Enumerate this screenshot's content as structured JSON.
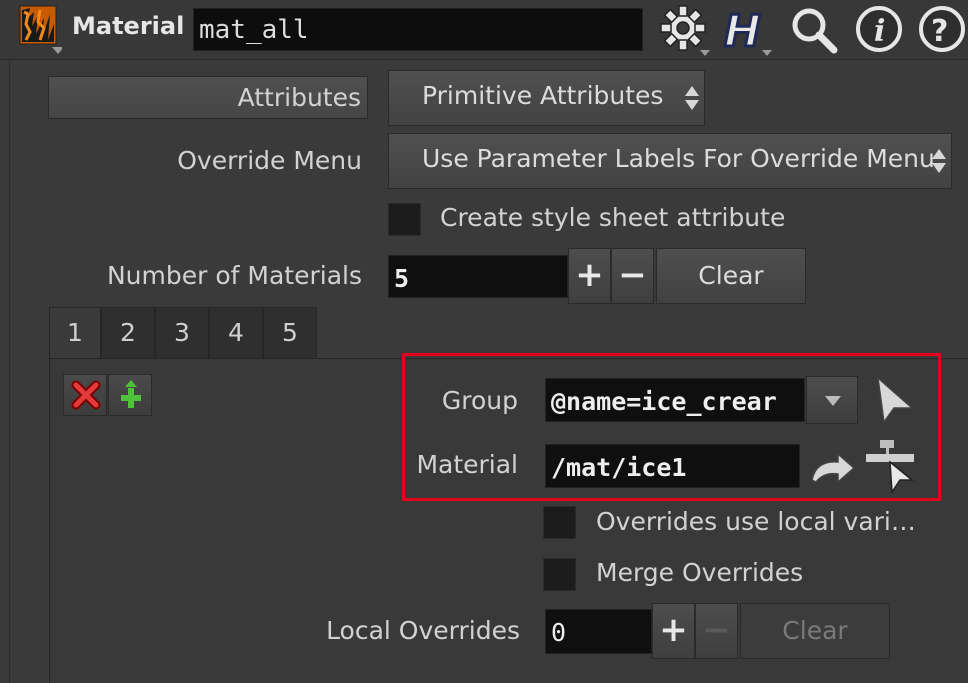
{
  "header": {
    "node_type": "Material",
    "node_name": "mat_all",
    "icons": [
      "node-type-icon",
      "gear-icon",
      "houdini-help-icon",
      "search-icon",
      "info-icon",
      "help-icon"
    ]
  },
  "params": {
    "attributes_label": "Attributes",
    "attributes_value": "Primitive Attributes",
    "override_menu_label": "Override Menu",
    "override_menu_value": "Use Parameter Labels For Override Menu",
    "create_style_sheet_label": "Create style sheet attribute",
    "num_materials_label": "Number of Materials",
    "num_materials_value": "5",
    "clear_label": "Clear"
  },
  "tabs": [
    "1",
    "2",
    "3",
    "4",
    "5"
  ],
  "material_block": {
    "group_label": "Group",
    "group_value": "@name=ice_crear",
    "material_label": "Material",
    "material_value": "/mat/ice1",
    "overrides_local_label": "Overrides use local vari…",
    "merge_overrides_label": "Merge Overrides",
    "local_overrides_label": "Local Overrides",
    "local_overrides_value": "0",
    "local_clear_label": "Clear"
  },
  "colors": {
    "highlight": "#e2001a",
    "background": "#3a3a3a",
    "field": "#0f0f0f"
  }
}
